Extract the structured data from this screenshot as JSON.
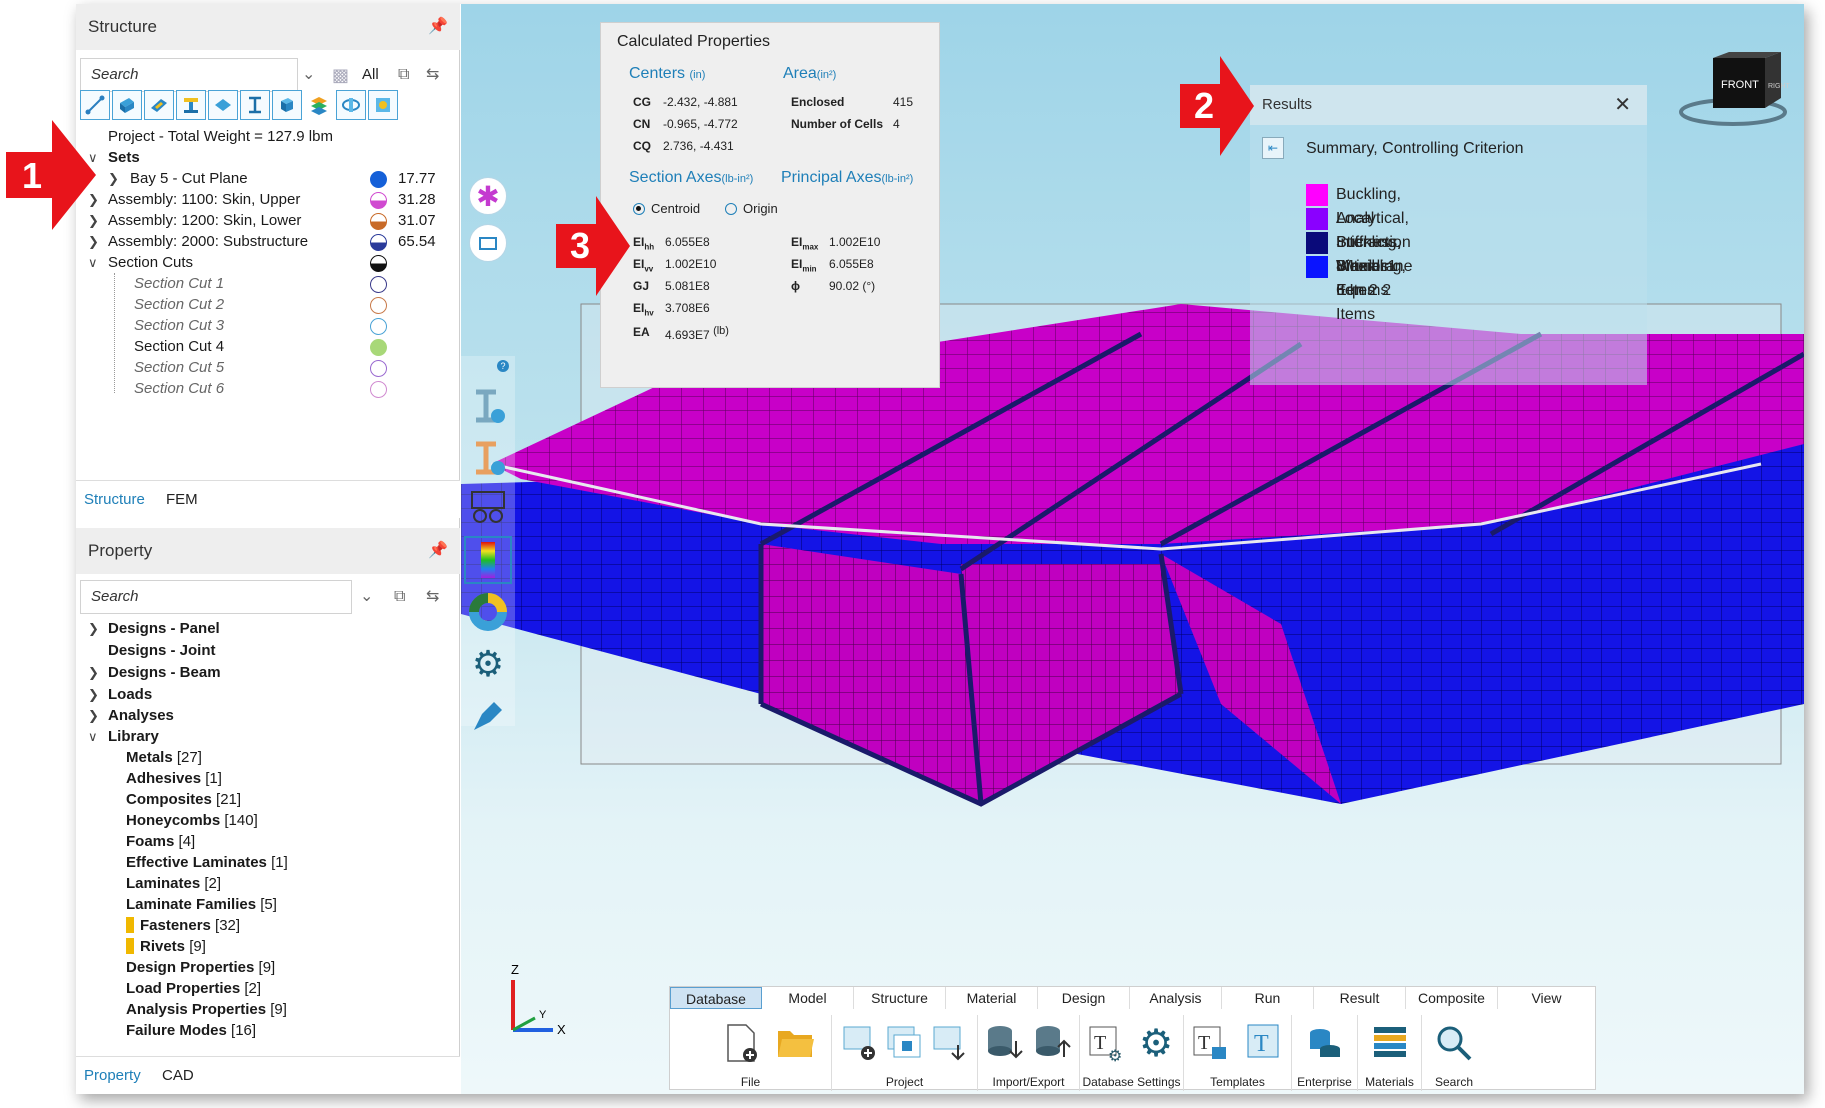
{
  "structure_panel": {
    "title": "Structure",
    "search_placeholder": "Search",
    "all_label": "All",
    "tree": {
      "project": "Project - Total Weight = 127.9 lbm",
      "sets_label": "Sets",
      "items": [
        {
          "label": "Bay 5 - Cut Plane",
          "value": "17.77",
          "color": "#1560d8"
        },
        {
          "label": "Assembly: 1100: Skin, Upper",
          "value": "31.28",
          "color": "#d04ad0"
        },
        {
          "label": "Assembly: 1200: Skin, Lower",
          "value": "31.07",
          "color": "#c86a28"
        },
        {
          "label": "Assembly: 2000: Substructure",
          "value": "65.54",
          "color": "#2a3a9a"
        }
      ],
      "section_cuts_label": "Section Cuts",
      "section_cuts": [
        {
          "label": "Section Cut 1",
          "color": "#3a3a8a",
          "active": false
        },
        {
          "label": "Section Cut 2",
          "color": "#c87a4a",
          "active": false
        },
        {
          "label": "Section Cut 3",
          "color": "#4aa3d6",
          "active": false
        },
        {
          "label": "Section Cut 4",
          "color": "#a8d878",
          "active": true
        },
        {
          "label": "Section Cut 5",
          "color": "#9a6ad0",
          "active": false
        },
        {
          "label": "Section Cut 6",
          "color": "#d08ad0",
          "active": false
        }
      ]
    },
    "tabs": [
      "Structure",
      "FEM"
    ]
  },
  "property_panel": {
    "title": "Property",
    "search_placeholder": "Search",
    "items": [
      {
        "label": "Designs - Panel",
        "expander": true
      },
      {
        "label": "Designs - Joint",
        "expander": false
      },
      {
        "label": "Designs - Beam",
        "expander": true
      },
      {
        "label": "Loads",
        "expander": true
      },
      {
        "label": "Analyses",
        "expander": true
      },
      {
        "label": "Library",
        "expander": true,
        "open": true
      }
    ],
    "library": [
      {
        "label": "Metals",
        "count": "[27]"
      },
      {
        "label": "Adhesives",
        "count": "[1]"
      },
      {
        "label": "Composites",
        "count": "[21]"
      },
      {
        "label": "Honeycombs",
        "count": "[140]"
      },
      {
        "label": "Foams",
        "count": "[4]"
      },
      {
        "label": "Effective Laminates",
        "count": "[1]"
      },
      {
        "label": "Laminates",
        "count": "[2]"
      },
      {
        "label": "Laminate Families",
        "count": "[5]"
      },
      {
        "label": "Fasteners",
        "count": "[32]",
        "icon": true
      },
      {
        "label": "Rivets",
        "count": "[9]",
        "icon": true
      },
      {
        "label": "Design Properties",
        "count": "[9]"
      },
      {
        "label": "Load Properties",
        "count": "[2]"
      },
      {
        "label": "Analysis Properties",
        "count": "[9]"
      },
      {
        "label": "Failure Modes",
        "count": "[16]"
      }
    ],
    "tabs": [
      "Property",
      "CAD"
    ]
  },
  "calculated_properties": {
    "title": "Calculated Properties",
    "centers": {
      "label": "Centers",
      "unit": "(in)",
      "rows": [
        {
          "k": "CG",
          "v": "-2.432, -4.881"
        },
        {
          "k": "CN",
          "v": "-0.965, -4.772"
        },
        {
          "k": "CQ",
          "v": "2.736, -4.431"
        }
      ]
    },
    "area": {
      "label": "Area",
      "unit": "(in²)",
      "rows": [
        {
          "k": "Enclosed",
          "v": "415"
        },
        {
          "k": "Number of Cells",
          "v": "4"
        }
      ]
    },
    "section_axes": {
      "label": "Section Axes",
      "unit": "(lb-in²)"
    },
    "principal_axes": {
      "label": "Principal Axes",
      "unit": "(lb-in²)"
    },
    "radio_centroid": "Centroid",
    "radio_origin": "Origin",
    "left_rows": [
      {
        "k": "EI",
        "s": "hh",
        "v": "6.055E8"
      },
      {
        "k": "EI",
        "s": "vv",
        "v": "1.002E10"
      },
      {
        "k": "GJ",
        "s": "",
        "v": "5.081E8"
      },
      {
        "k": "EI",
        "s": "hv",
        "v": "3.708E6"
      },
      {
        "k": "EA",
        "s": "",
        "v": "4.693E7",
        "u": "(lb)"
      }
    ],
    "right_rows": [
      {
        "k": "EI",
        "s": "max",
        "v": "1.002E10"
      },
      {
        "k": "EI",
        "s": "min",
        "v": "6.055E8"
      },
      {
        "k": "ϕ",
        "s": "",
        "v": "90.02",
        "u": "(°)"
      }
    ]
  },
  "results": {
    "title": "Results",
    "summary": "Summary, Controlling Criterion",
    "legend": [
      {
        "label": "Buckling, Analytical, Interaction 8 Items",
        "color": "#ff00ff"
      },
      {
        "label": "Local Buckling, Biaxial 1 Items",
        "color": "#8a00ff"
      },
      {
        "label": "Stiffness, Membrane 6 Items",
        "color": "#0a0a7a"
      },
      {
        "label": "Wrinkling, Eqn 2 2 Items",
        "color": "#0a14ff"
      }
    ]
  },
  "view_cube": {
    "front": "FRONT",
    "right": "RIGHT"
  },
  "axes": {
    "x": "X",
    "y": "Y",
    "z": "Z"
  },
  "ribbon": {
    "tabs": [
      "Database",
      "Model",
      "Structure",
      "Material",
      "Design",
      "Analysis",
      "Run",
      "Result",
      "Composite",
      "View"
    ],
    "active_tab": "Database",
    "groups": [
      "File",
      "Project",
      "Import/Export",
      "Database Settings",
      "Templates",
      "Enterprise",
      "Materials",
      "Search"
    ]
  },
  "callouts": [
    "1",
    "2",
    "3"
  ],
  "colors": {
    "accent": "#1e7fb8",
    "callout": "#e8141b",
    "magenta": "#cc00cc",
    "blue": "#1515e0"
  }
}
